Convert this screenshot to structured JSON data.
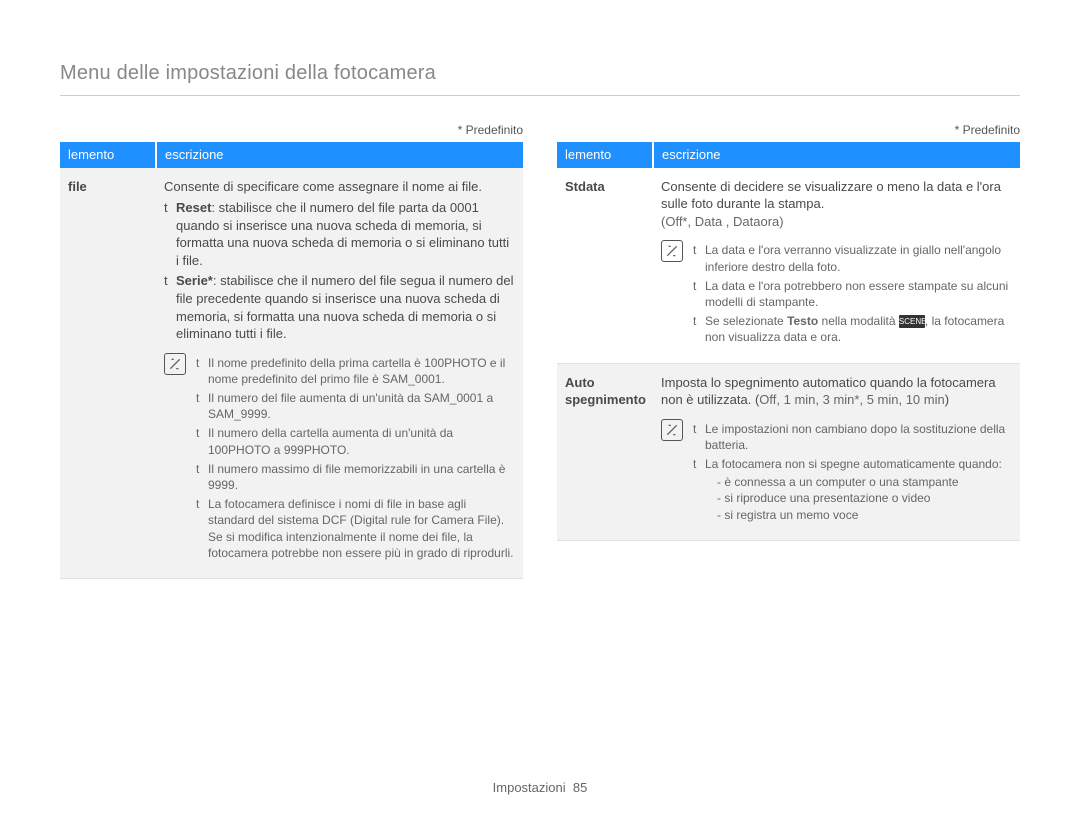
{
  "page": {
    "title": "Menu delle impostazioni della fotocamera",
    "footer_label": "Impostazioni",
    "footer_page": "85"
  },
  "predef": "* Predefinito",
  "table_headers": {
    "col1": "lemento",
    "col2": "escrizione"
  },
  "left": {
    "row1": {
      "label": "file",
      "intro": "Consente di specificare come assegnare il nome ai file.",
      "reset_term": "Reset",
      "reset_desc": ": stabilisce che il numero del file parta da 0001 quando si inserisce una nuova scheda di memoria, si formatta una nuova scheda di memoria o si eliminano tutti i file.",
      "serie_term": "Serie*",
      "serie_desc": ": stabilisce che il numero del file segua il numero del file precedente quando si inserisce una nuova scheda di memoria, si formatta una nuova scheda di memoria o si eliminano tutti i file.",
      "notes": [
        "Il nome predefinito della prima cartella è 100PHOTO e il nome predefinito del primo file è SAM_0001.",
        "Il numero del file aumenta di un'unità da SAM_0001 a SAM_9999.",
        "Il numero della cartella aumenta di un'unità da 100PHOTO a 999PHOTO.",
        "Il numero massimo di file memorizzabili in una cartella è 9999.",
        "La fotocamera definisce i nomi di file in base agli standard del sistema DCF (Digital rule for Camera File). Se si modifica intenzionalmente il nome dei file, la fotocamera potrebbe non essere più in grado di riprodurli."
      ]
    }
  },
  "right": {
    "row1": {
      "label": "Stdata",
      "intro": "Consente di decidere se visualizzare o meno la data e l'ora sulle foto durante la stampa.",
      "options": "(Off*, Data , Dataora)",
      "notes": {
        "n1": "La data e l'ora verranno visualizzate in giallo nell'angolo inferiore destro della foto.",
        "n2": "La data e l'ora potrebbero non essere stampate su alcuni modelli di stampante.",
        "n3_pre": "Se selezionate ",
        "n3_bold": "Testo",
        "n3_mid": " nella modalità ",
        "n3_badge": "SCENE",
        "n3_post": ", la fotocamera non visualizza data e ora."
      }
    },
    "row2": {
      "label": "Auto spegnimento",
      "intro_pre": "Imposta lo spegnimento automatico quando la fotocamera non è utilizzata. (",
      "intro_opts": "Off, 1 min, 3 min*, 5 min, 10 min",
      "intro_post": ")",
      "notes": {
        "n1": "Le impostazioni non cambiano dopo la sostituzione della batteria.",
        "n2": "La fotocamera non si spegne automaticamente quando:",
        "sub": [
          "è connessa a un computer o una stampante",
          "si riproduce una presentazione o video",
          "si registra un memo voce"
        ]
      }
    }
  }
}
